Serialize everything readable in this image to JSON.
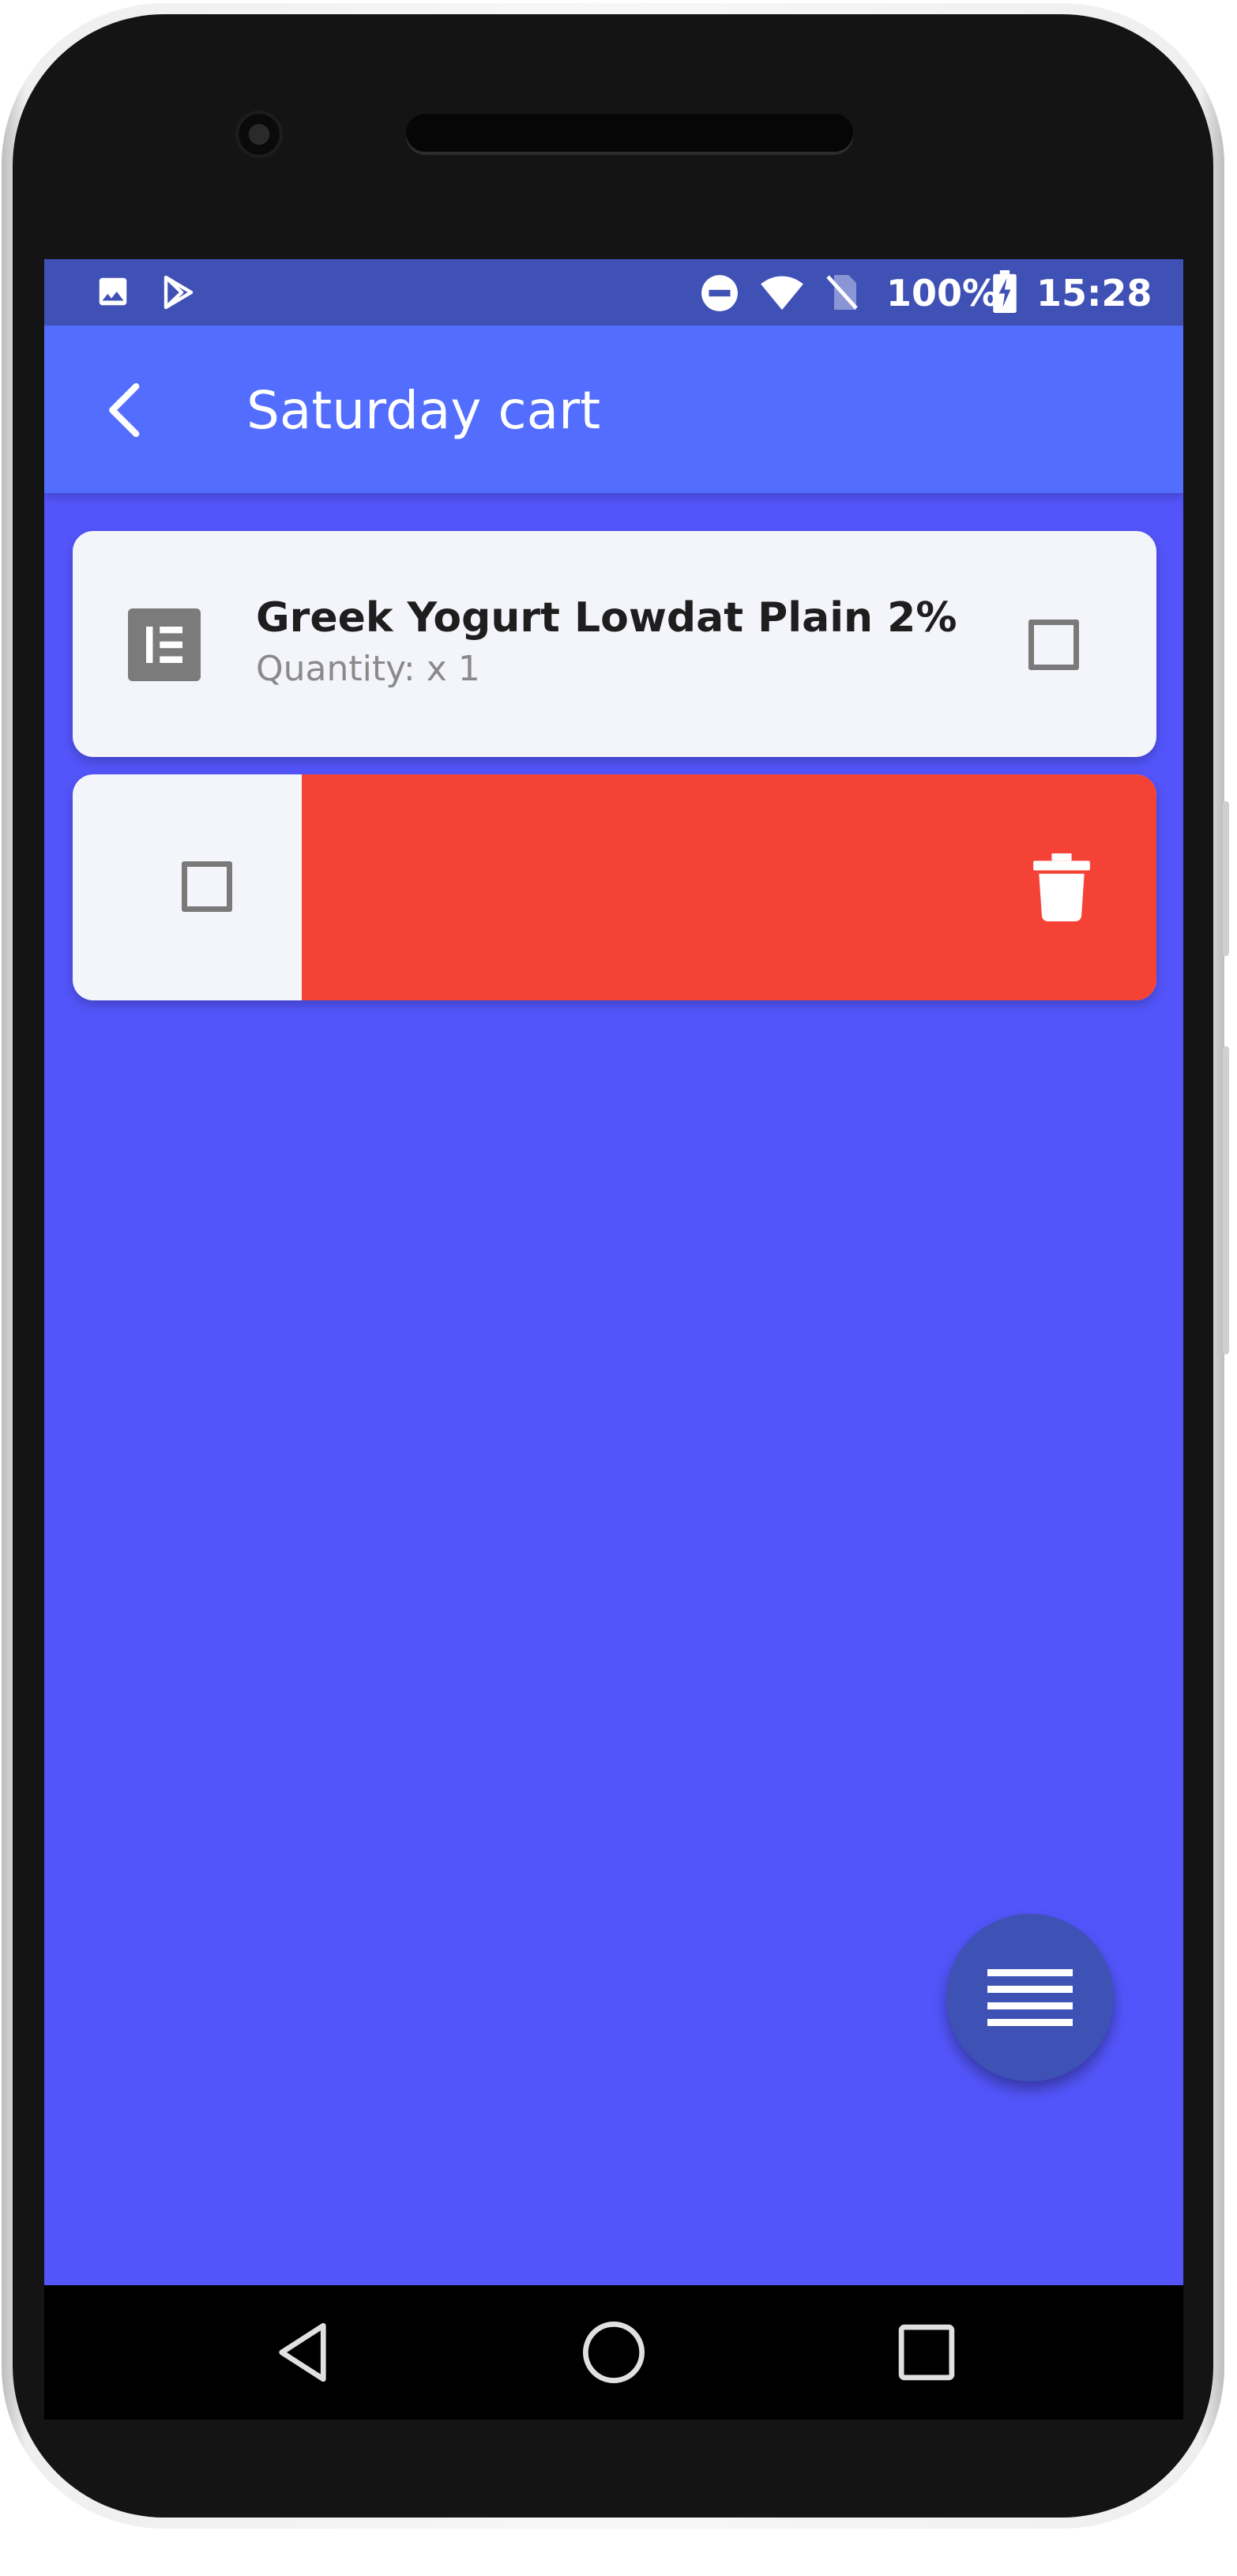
{
  "status_bar": {
    "battery": "100%",
    "time": "15:28",
    "icons": [
      "image-icon",
      "play-store-icon",
      "do-not-disturb-icon",
      "wifi-icon",
      "no-sim-icon",
      "battery-charging-icon"
    ]
  },
  "app_bar": {
    "title": "Saturday cart",
    "back_icon": "back-arrow-icon"
  },
  "items": [
    {
      "name": "Greek Yogurt Lowdat Plain 2%",
      "quantity": "Quantity: x 1",
      "checked": false,
      "icon": "list-icon"
    }
  ],
  "swiped_item": {
    "checked": false,
    "delete_icon": "trash-icon",
    "delete_color": "#f44336"
  },
  "fab": {
    "icon": "menu-icon"
  },
  "colors": {
    "background": "#5355fb",
    "app_bar": "#536dfe",
    "status_bar": "#3f51b5",
    "fab": "#3e51b5",
    "card": "#f4f5fb"
  },
  "nav_bar": {
    "icons": [
      "back-triangle-icon",
      "home-circle-icon",
      "recents-square-icon"
    ]
  }
}
